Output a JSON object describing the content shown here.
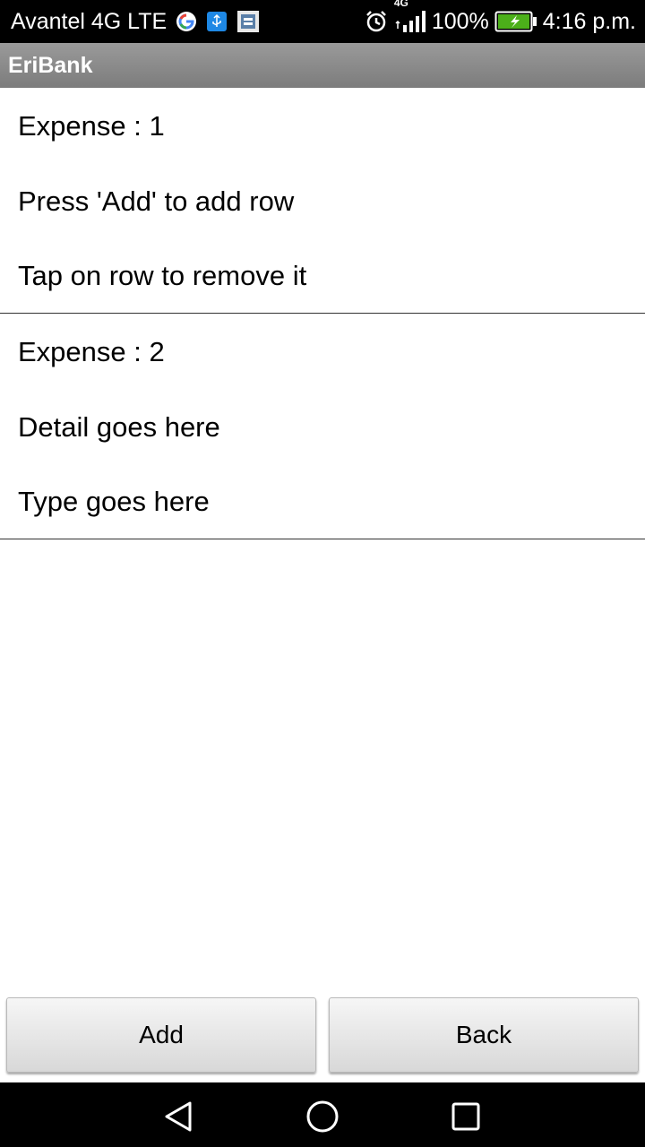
{
  "status_bar": {
    "carrier": "Avantel 4G LTE",
    "network_type": "4G",
    "battery": "100%",
    "time": "4:16 p.m.",
    "icons": [
      "google-icon",
      "usb-icon",
      "notification-app-icon",
      "alarm-icon",
      "signal-icon",
      "battery-charging-icon"
    ]
  },
  "app_bar": {
    "title": "EriBank"
  },
  "expenses": [
    {
      "line1": "Expense : 1",
      "line2": "Press 'Add' to add row",
      "line3": "Tap on row to remove it"
    },
    {
      "line1": "Expense : 2",
      "line2": "Detail goes here",
      "line3": "Type goes here"
    }
  ],
  "actions": {
    "add_label": "Add",
    "back_label": "Back"
  },
  "nav_bar": {
    "icons": [
      "back-triangle-icon",
      "home-circle-icon",
      "recents-square-icon"
    ]
  },
  "colors": {
    "status_bar_bg": "#000000",
    "app_bar_bg": "#8a8a8a",
    "battery_green": "#4caf1a"
  }
}
